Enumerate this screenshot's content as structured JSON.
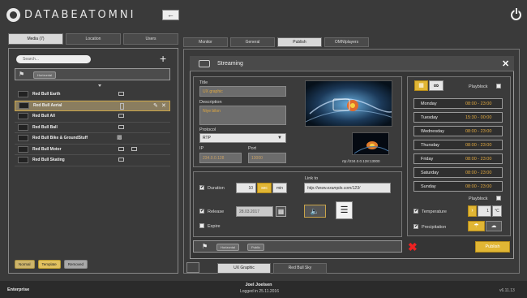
{
  "app": {
    "logo_text": "DATABEATOMNI"
  },
  "left": {
    "tabs": [
      "Media (7)",
      "Location",
      "Users"
    ],
    "search_placeholder": "Search...",
    "filter_tag": "Horizontal",
    "items": [
      "Red Bull Earth",
      "Red Bull Aerial",
      "Red Bull All",
      "Red Bull Ball",
      "Red Bull Bike & GroundStuff",
      "Red Bull Motor",
      "Red Bull Skating"
    ],
    "legend": [
      "Normal",
      "Template",
      "Removed"
    ]
  },
  "right": {
    "tabs": [
      "Monitor",
      "General",
      "Publish",
      "OMNIplayers"
    ],
    "active_tab": "Publish"
  },
  "streaming": {
    "title": "Streaming",
    "title_label": "Title",
    "title_value": "UX graphic",
    "description_label": "Description",
    "description_value": "Niye bilon",
    "protocol_label": "Protocol",
    "protocol_value": "RTP",
    "ip_label": "IP",
    "ip_value": "234.0.0.128",
    "port_label": "Port",
    "port_value": "13000",
    "rtp_url": "rtp://234.0.0.128:13000",
    "duration_label": "Duration",
    "duration_value": "10",
    "duration_unit_active": "sec",
    "duration_unit": "min",
    "release_label": "Release",
    "release_value": "28.03.2017",
    "expire_label": "Expire",
    "link_label": "Link to",
    "link_value": "http://www.example.com/123/",
    "tags": [
      "Horizontal",
      "Public"
    ],
    "publish_button": "Publish"
  },
  "schedule": {
    "playblock_label": "Playblock",
    "days": [
      {
        "day": "Monday",
        "time": "08:00 - 23:00"
      },
      {
        "day": "Tuesday",
        "time": "15:30 - 00:00"
      },
      {
        "day": "Wednesday",
        "time": "08:00 - 23:00"
      },
      {
        "day": "Thursday",
        "time": "08:00 - 23:00"
      },
      {
        "day": "Friday",
        "time": "08:00 - 23:00"
      },
      {
        "day": "Saturday",
        "time": "08:00 - 23:00"
      },
      {
        "day": "Sunday",
        "time": "08:00 - 23:00"
      }
    ],
    "playblock2_label": "Playblock",
    "temperature_label": "Temperature",
    "temperature_value": "1",
    "temperature_unit": "°C",
    "precipitation_label": "Precipitation"
  },
  "bottom_tabs": [
    "UX Graphic",
    "Red Bull Sky"
  ],
  "footer": {
    "edition": "Enterprise",
    "user_name": "Joel Joelsen",
    "logged_in": "Logged in 25.11.2016",
    "version": "v6.11.13"
  },
  "colors": {
    "accent": "#e1b634",
    "danger": "#e22222",
    "background": "#3a3a3a"
  }
}
